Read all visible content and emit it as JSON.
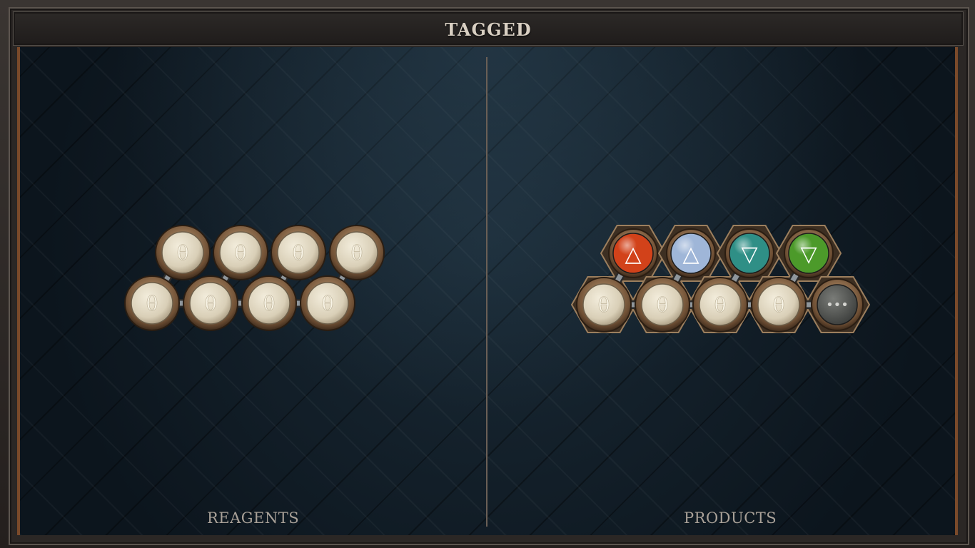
{
  "window": {
    "title": "TAGGED"
  },
  "panels": {
    "left": {
      "label": "REAGENTS"
    },
    "right": {
      "label": "PRODUCTS"
    }
  },
  "reagents": {
    "top_row": [
      "θ",
      "θ",
      "θ",
      "θ"
    ],
    "bottom_row": [
      "θ",
      "θ",
      "θ",
      "θ"
    ]
  },
  "products": {
    "top_row": [
      {
        "element": "fire",
        "symbol": "△",
        "color": "#d2421a"
      },
      {
        "element": "air",
        "symbol": "△",
        "color": "#9fb6d8"
      },
      {
        "element": "water",
        "symbol": "▽",
        "color": "#2f8f86"
      },
      {
        "element": "earth",
        "symbol": "▽",
        "color": "#4c9a2a"
      }
    ],
    "bottom_row": [
      "θ",
      "θ",
      "θ",
      "θ"
    ],
    "more_symbol": "•••"
  },
  "colors": {
    "bone": "#e9e2cf",
    "bronze": "#8a6a48",
    "pipe": "#8f969c"
  }
}
